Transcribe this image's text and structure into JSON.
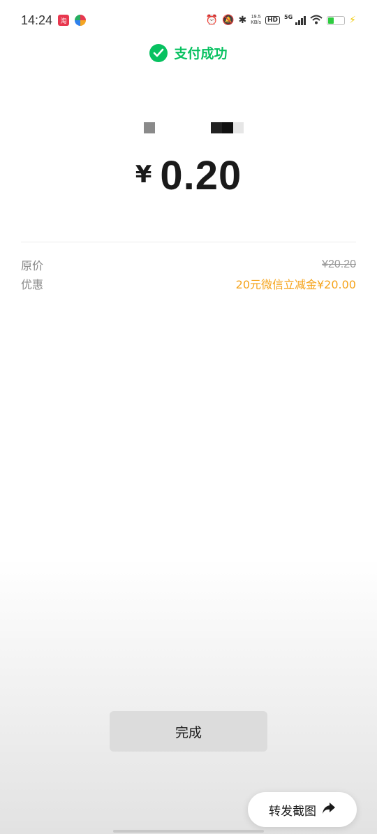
{
  "status_bar": {
    "time": "14:24",
    "net_speed_value": "19.5",
    "net_speed_unit": "KB/s",
    "hd_label": "HD",
    "network_label": "5G"
  },
  "header": {
    "title": "支付成功",
    "icon": "wechat-pay-check-icon"
  },
  "payment": {
    "currency": "¥",
    "amount": "0.20"
  },
  "details": {
    "original_label": "原价",
    "original_value": "¥20.20",
    "discount_label": "优惠",
    "discount_value": "20元微信立减金¥20.00"
  },
  "actions": {
    "done_label": "完成",
    "share_label": "转发截图"
  },
  "colors": {
    "wechat_green": "#07c160",
    "discount_orange": "#f5a31a"
  }
}
